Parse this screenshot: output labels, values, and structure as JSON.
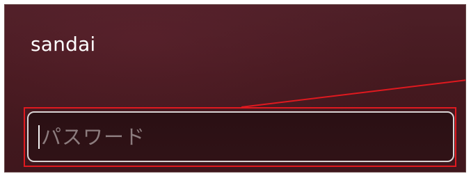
{
  "login": {
    "username": "sandai",
    "password_placeholder": "パスワード",
    "password_value": ""
  },
  "annotation": {
    "color": "#e0191f"
  },
  "colors": {
    "background": "#45191f",
    "field_border": "#d9d4d4",
    "placeholder": "#8c7c7e"
  }
}
